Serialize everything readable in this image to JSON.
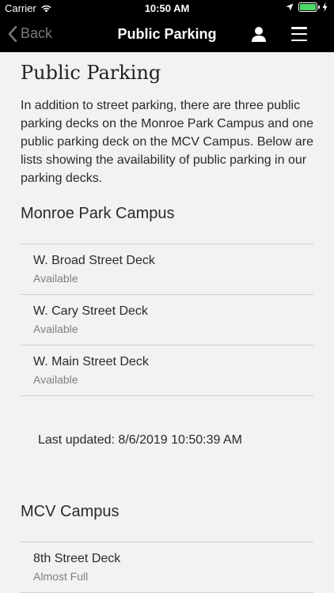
{
  "status_bar": {
    "carrier": "Carrier",
    "time": "10:50 AM"
  },
  "nav": {
    "back_label": "Back",
    "title": "Public Parking"
  },
  "page": {
    "title": "Public Parking",
    "intro": "In addition to street parking, there are three public parking decks on the Monroe Park Campus and one public parking deck on the MCV Campus. Below are lists showing the availability of public parking in our parking decks.",
    "last_updated": "Last updated: 8/6/2019 10:50:39 AM"
  },
  "sections": [
    {
      "title": "Monroe Park Campus",
      "decks": [
        {
          "name": "W. Broad Street Deck",
          "status": "Available"
        },
        {
          "name": "W. Cary Street Deck",
          "status": "Available"
        },
        {
          "name": "W. Main Street Deck",
          "status": "Available"
        }
      ]
    },
    {
      "title": "MCV Campus",
      "decks": [
        {
          "name": "8th Street Deck",
          "status": "Almost Full"
        }
      ]
    }
  ],
  "colors": {
    "battery": "#4cd964",
    "header_bg": "#000000"
  },
  "icons": [
    "wifi-icon",
    "location-icon",
    "battery-icon",
    "charging-icon",
    "chevron-left-icon",
    "user-icon",
    "menu-icon"
  ]
}
